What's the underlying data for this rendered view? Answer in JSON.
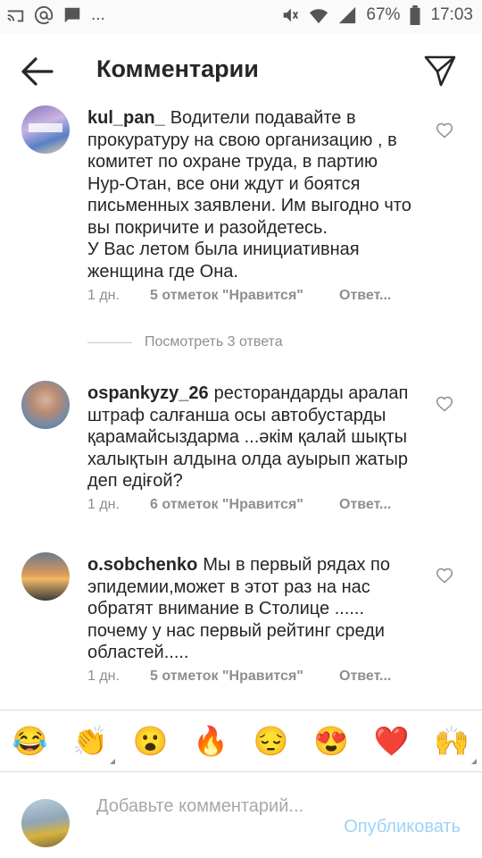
{
  "status_bar": {
    "battery": "67%",
    "time": "17:03",
    "left_icons": [
      "cast-icon",
      "at-icon",
      "message-icon",
      "more-dots"
    ],
    "right_icons": [
      "mute-icon",
      "wifi-icon",
      "signal-icon",
      "battery-icon"
    ],
    "more": "..."
  },
  "header": {
    "title": "Комментарии"
  },
  "comments": [
    {
      "user": "kul_pan_",
      "text": "Водители подавайте в прокуратуру на свою организацию , в комитет по охране труда, в партию Нур-Отан, все они ждут и боятся письменных заявлени. Им выгодно что вы покричите и разойдетесь.\nУ Вас летом была инициативная женщина где Она.",
      "time": "1 дн.",
      "likes": "5 отметок \"Нравится\"",
      "reply": "Ответ..."
    },
    {
      "user": "ospankyzy_26",
      "text": "ресторандарды аралап штраф салғанша осы автобустарды қарамайсыздарма ...әкім қалай шықты халықтын алдына олда ауырып жатыр деп едіғой?",
      "time": "1 дн.",
      "likes": "6 отметок \"Нравится\"",
      "reply": "Ответ..."
    },
    {
      "user": "o.sobchenko",
      "text": "Мы в первый рядах по эпидемии,может в этот раз на нас обратят внимание в Столице ...... почему у нас первый рейтинг среди областей.....",
      "time": "1 дн.",
      "likes": "5 отметок \"Нравится\"",
      "reply": "Ответ..."
    }
  ],
  "view_replies": "Посмотреть 3 ответа",
  "emojis": [
    "😂",
    "👏",
    "😮",
    "🔥",
    "😔",
    "😍",
    "❤️",
    "🙌"
  ],
  "composer": {
    "placeholder": "Добавьте комментарий...",
    "publish": "Опубликовать"
  },
  "colors": {
    "text": "#262626",
    "meta": "#8e8e8e",
    "publish_disabled": "#9fd2f6",
    "heart_red": "#ed4956"
  }
}
